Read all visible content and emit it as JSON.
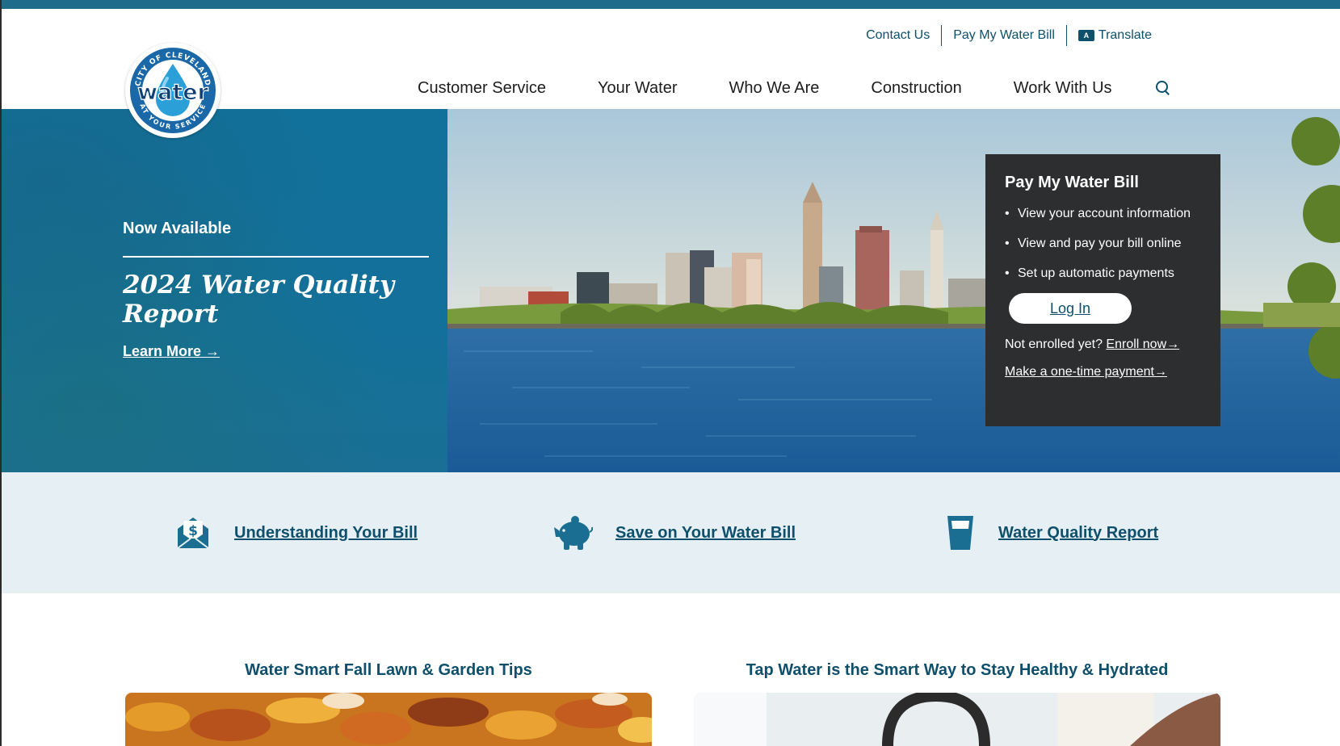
{
  "utility_nav": {
    "contact": "Contact Us",
    "pay_bill": "Pay My Water Bill",
    "translate": "Translate",
    "translate_icon": "translate-icon"
  },
  "main_nav": {
    "items": [
      "Customer Service",
      "Your Water",
      "Who We Are",
      "Construction",
      "Work With Us"
    ],
    "search_icon": "search-icon"
  },
  "logo": {
    "top_text": "CITY OF CLEVELAND",
    "word": "water",
    "bottom_text": "AT YOUR SERVICE"
  },
  "hero": {
    "eyebrow": "Now Available",
    "title": "2024 Water Quality Report",
    "link": "Learn More",
    "link_arrow": "→"
  },
  "pay_panel": {
    "title": "Pay My Water Bill",
    "bullets": [
      "View your account information",
      "View and pay your bill online",
      "Set up automatic payments"
    ],
    "login": "Log In",
    "not_enrolled": "Not enrolled yet?",
    "enroll": "Enroll now→",
    "one_time": "Make a one-time payment→"
  },
  "quick_links": [
    {
      "label": "Understanding Your Bill",
      "icon": "bill-envelope-icon"
    },
    {
      "label": "Save on Your Water Bill",
      "icon": "piggy-bank-icon"
    },
    {
      "label": "Water Quality Report",
      "icon": "water-glass-icon"
    }
  ],
  "articles": [
    {
      "title": "Water Smart Fall Lawn & Garden Tips"
    },
    {
      "title": "Tap Water is the Smart Way to Stay Healthy & Hydrated"
    }
  ],
  "colors": {
    "brand": "#0e4f6b",
    "hero_blue": "#13709a",
    "panel_dark": "#2c2e2f",
    "band_bg": "#e6f0f4"
  }
}
